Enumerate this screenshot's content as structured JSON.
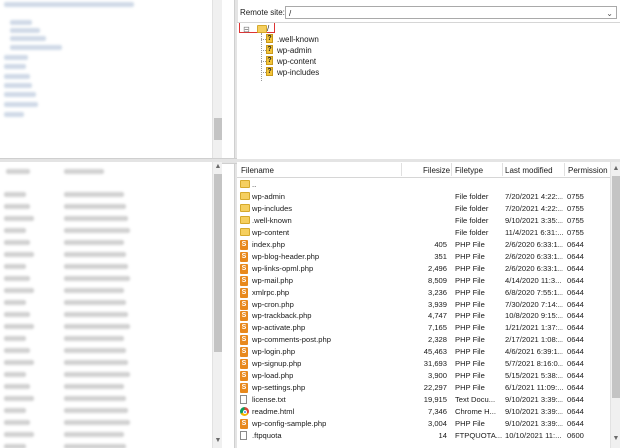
{
  "remote_site": {
    "label": "Remote site:",
    "path": "/"
  },
  "tree": {
    "root": "/",
    "items": [
      {
        "label": ".well-known"
      },
      {
        "label": "wp-admin"
      },
      {
        "label": "wp-content"
      },
      {
        "label": "wp-includes"
      }
    ]
  },
  "columns": {
    "filename": "Filename",
    "filesize": "Filesize",
    "filetype": "Filetype",
    "last_modified": "Last modified",
    "permissions": "Permission"
  },
  "files": [
    {
      "name": "..",
      "size": "",
      "type": "",
      "modified": "",
      "perms": "",
      "icon": "folder-icon"
    },
    {
      "name": "wp-admin",
      "size": "",
      "type": "File folder",
      "modified": "7/20/2021 4:22:...",
      "perms": "0755",
      "icon": "folder-icon"
    },
    {
      "name": "wp-includes",
      "size": "",
      "type": "File folder",
      "modified": "7/20/2021 4:22:...",
      "perms": "0755",
      "icon": "folder-icon"
    },
    {
      "name": ".well-known",
      "size": "",
      "type": "File folder",
      "modified": "9/10/2021 3:35:...",
      "perms": "0755",
      "icon": "folder-icon"
    },
    {
      "name": "wp-content",
      "size": "",
      "type": "File folder",
      "modified": "11/4/2021 6:31:...",
      "perms": "0755",
      "icon": "folder-icon"
    },
    {
      "name": "index.php",
      "size": "405",
      "type": "PHP File",
      "modified": "2/6/2020 6:33:1...",
      "perms": "0644",
      "icon": "php-file-icon"
    },
    {
      "name": "wp-blog-header.php",
      "size": "351",
      "type": "PHP File",
      "modified": "2/6/2020 6:33:1...",
      "perms": "0644",
      "icon": "php-file-icon"
    },
    {
      "name": "wp-links-opml.php",
      "size": "2,496",
      "type": "PHP File",
      "modified": "2/6/2020 6:33:1...",
      "perms": "0644",
      "icon": "php-file-icon"
    },
    {
      "name": "wp-mail.php",
      "size": "8,509",
      "type": "PHP File",
      "modified": "4/14/2020 11:3...",
      "perms": "0644",
      "icon": "php-file-icon"
    },
    {
      "name": "xmlrpc.php",
      "size": "3,236",
      "type": "PHP File",
      "modified": "6/8/2020 7:55:1...",
      "perms": "0644",
      "icon": "php-file-icon"
    },
    {
      "name": "wp-cron.php",
      "size": "3,939",
      "type": "PHP File",
      "modified": "7/30/2020 7:14:...",
      "perms": "0644",
      "icon": "php-file-icon"
    },
    {
      "name": "wp-trackback.php",
      "size": "4,747",
      "type": "PHP File",
      "modified": "10/8/2020 9:15:...",
      "perms": "0644",
      "icon": "php-file-icon"
    },
    {
      "name": "wp-activate.php",
      "size": "7,165",
      "type": "PHP File",
      "modified": "1/21/2021 1:37:...",
      "perms": "0644",
      "icon": "php-file-icon"
    },
    {
      "name": "wp-comments-post.php",
      "size": "2,328",
      "type": "PHP File",
      "modified": "2/17/2021 1:08:...",
      "perms": "0644",
      "icon": "php-file-icon"
    },
    {
      "name": "wp-login.php",
      "size": "45,463",
      "type": "PHP File",
      "modified": "4/6/2021 6:39:1...",
      "perms": "0644",
      "icon": "php-file-icon"
    },
    {
      "name": "wp-signup.php",
      "size": "31,693",
      "type": "PHP File",
      "modified": "5/7/2021 8:16:0...",
      "perms": "0644",
      "icon": "php-file-icon"
    },
    {
      "name": "wp-load.php",
      "size": "3,900",
      "type": "PHP File",
      "modified": "5/15/2021 5:38:...",
      "perms": "0644",
      "icon": "php-file-icon"
    },
    {
      "name": "wp-settings.php",
      "size": "22,297",
      "type": "PHP File",
      "modified": "6/1/2021 11:09:...",
      "perms": "0644",
      "icon": "php-file-icon"
    },
    {
      "name": "license.txt",
      "size": "19,915",
      "type": "Text Docu...",
      "modified": "9/10/2021 3:39:...",
      "perms": "0644",
      "icon": "text-file-icon"
    },
    {
      "name": "readme.html",
      "size": "7,346",
      "type": "Chrome H...",
      "modified": "9/10/2021 3:39:...",
      "perms": "0644",
      "icon": "chrome-html-icon"
    },
    {
      "name": "wp-config-sample.php",
      "size": "3,004",
      "type": "PHP File",
      "modified": "9/10/2021 3:39:...",
      "perms": "0644",
      "icon": "php-file-icon"
    },
    {
      "name": ".ftpquota",
      "size": "14",
      "type": "FTPQUOTA...",
      "modified": "10/10/2021 11:...",
      "perms": "0600",
      "icon": "text-file-icon"
    }
  ]
}
